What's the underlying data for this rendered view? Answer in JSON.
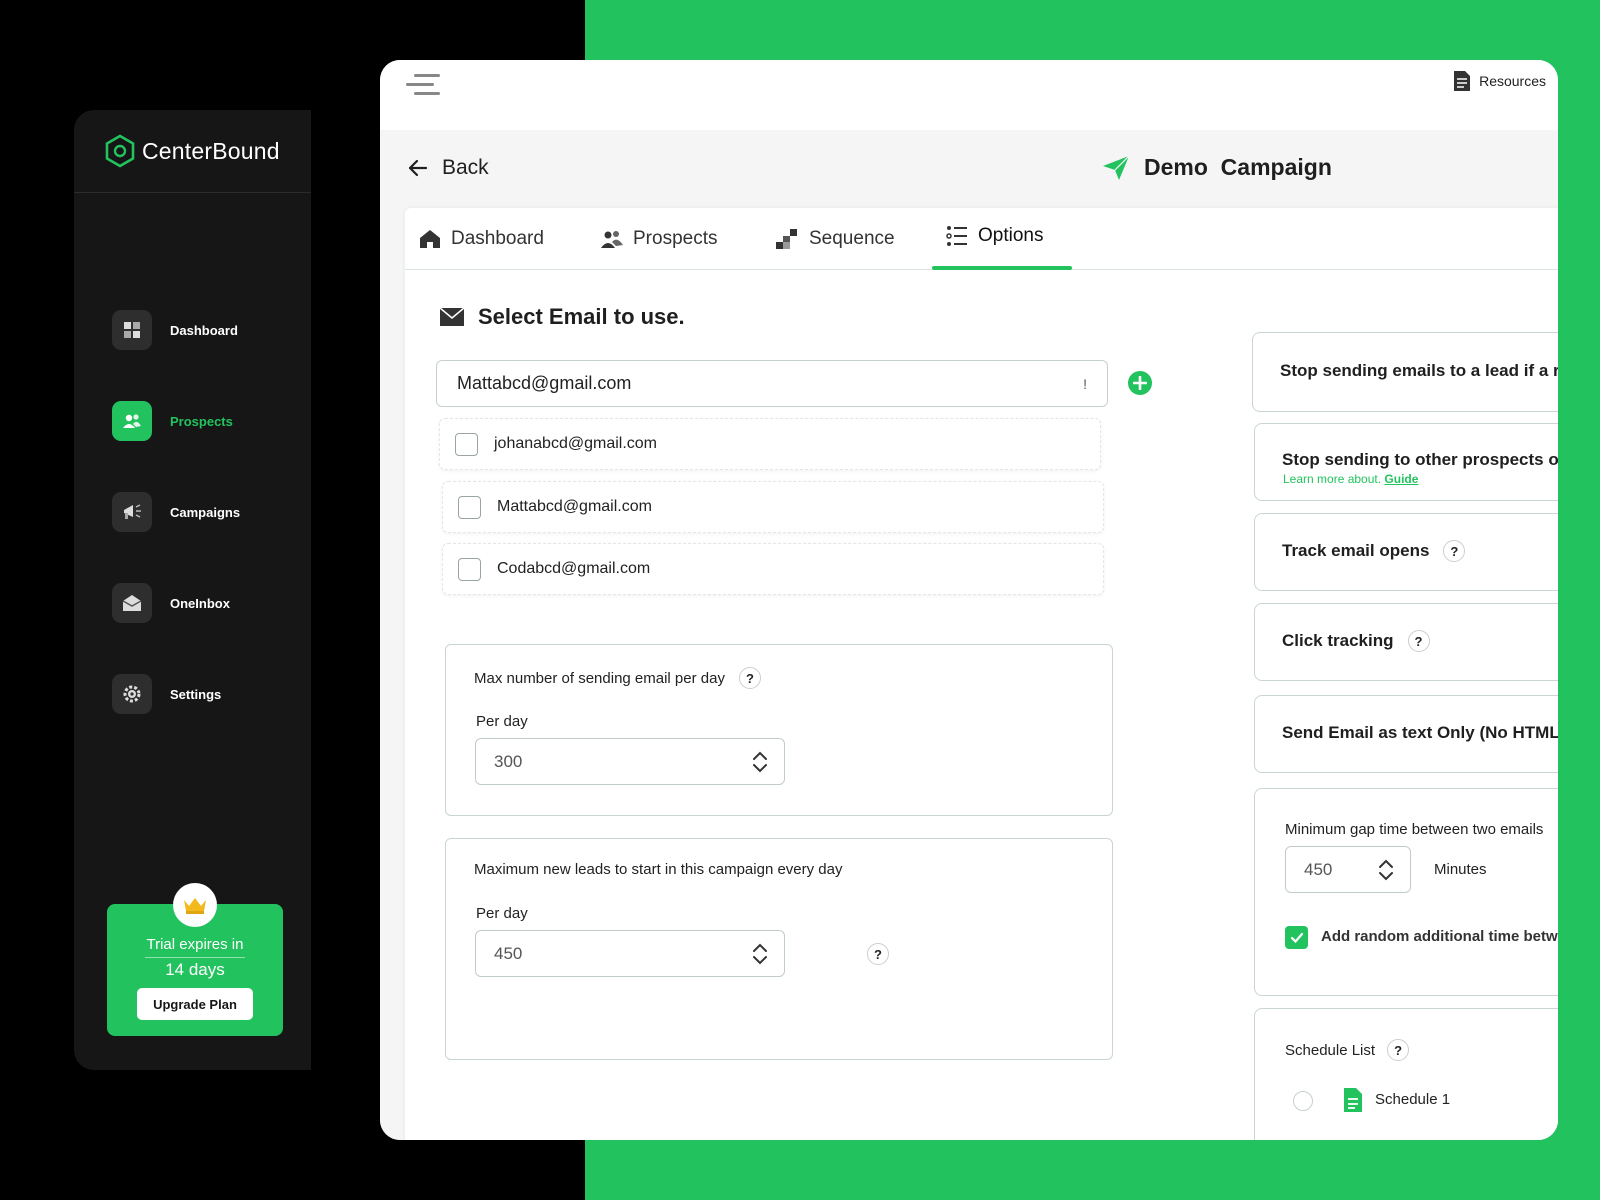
{
  "brand": {
    "name": "CenterBound",
    "accent": "#22c35e",
    "background_green": "#22c35e",
    "sidebar_bg": "#161616"
  },
  "sidebar": {
    "items": [
      {
        "label": "Dashboard",
        "icon": "dashboard-grid-icon",
        "active": false
      },
      {
        "label": "Prospects",
        "icon": "prospects-people-icon",
        "active": true
      },
      {
        "label": "Campaigns",
        "icon": "megaphone-icon",
        "active": false
      },
      {
        "label": "OneInbox",
        "icon": "inbox-envelope-icon",
        "active": false
      },
      {
        "label": "Settings",
        "icon": "gear-icon",
        "active": false
      }
    ],
    "trial": {
      "line1": "Trial expires in",
      "line2": "14 days",
      "button": "Upgrade Plan",
      "icon": "crown-icon"
    }
  },
  "topbar": {
    "resources_label": "Resources",
    "menu_icon": "hamburger-icon",
    "resources_icon": "document-icon"
  },
  "header": {
    "back_label": "Back",
    "campaign_title": "Demo  Campaign",
    "campaign_icon": "paper-plane-icon"
  },
  "tabs": [
    {
      "label": "Dashboard",
      "icon": "home-icon",
      "active": false
    },
    {
      "label": "Prospects",
      "icon": "people-icon",
      "active": false
    },
    {
      "label": "Sequence",
      "icon": "steps-icon",
      "active": false
    },
    {
      "label": "Options",
      "icon": "options-list-icon",
      "active": true
    }
  ],
  "email_section": {
    "title": "Select Email to use.",
    "selected": "Mattabcd@gmail.com",
    "indicator": "!",
    "options": [
      "johanabcd@gmail.com",
      "Mattabcd@gmail.com",
      "Codabcd@gmail.com"
    ]
  },
  "limits": {
    "max_sending": {
      "label": "Max number of sending email per day",
      "sublabel": "Per day",
      "value": "300"
    },
    "max_new_leads": {
      "label": "Maximum new leads to start in this campaign every day",
      "sublabel": "Per day",
      "value": "450"
    }
  },
  "right_options": {
    "stop_reply": "Stop sending emails to a lead if a re",
    "stop_other": "Stop sending to other prospects or",
    "learn_prefix": "Learn more about.",
    "learn_link": "Guide",
    "track_opens": "Track email opens",
    "click_tracking": "Click tracking",
    "text_only": "Send Email as text Only (No HTML)",
    "min_gap_label": "Minimum gap time between two emails",
    "min_gap_value": "450",
    "min_gap_unit": "Minutes",
    "random_time_label": "Add random additional time betw",
    "random_time_checked": true,
    "schedule_list_label": "Schedule List",
    "schedules": [
      "Schedule 1"
    ]
  },
  "help_mark": "?"
}
